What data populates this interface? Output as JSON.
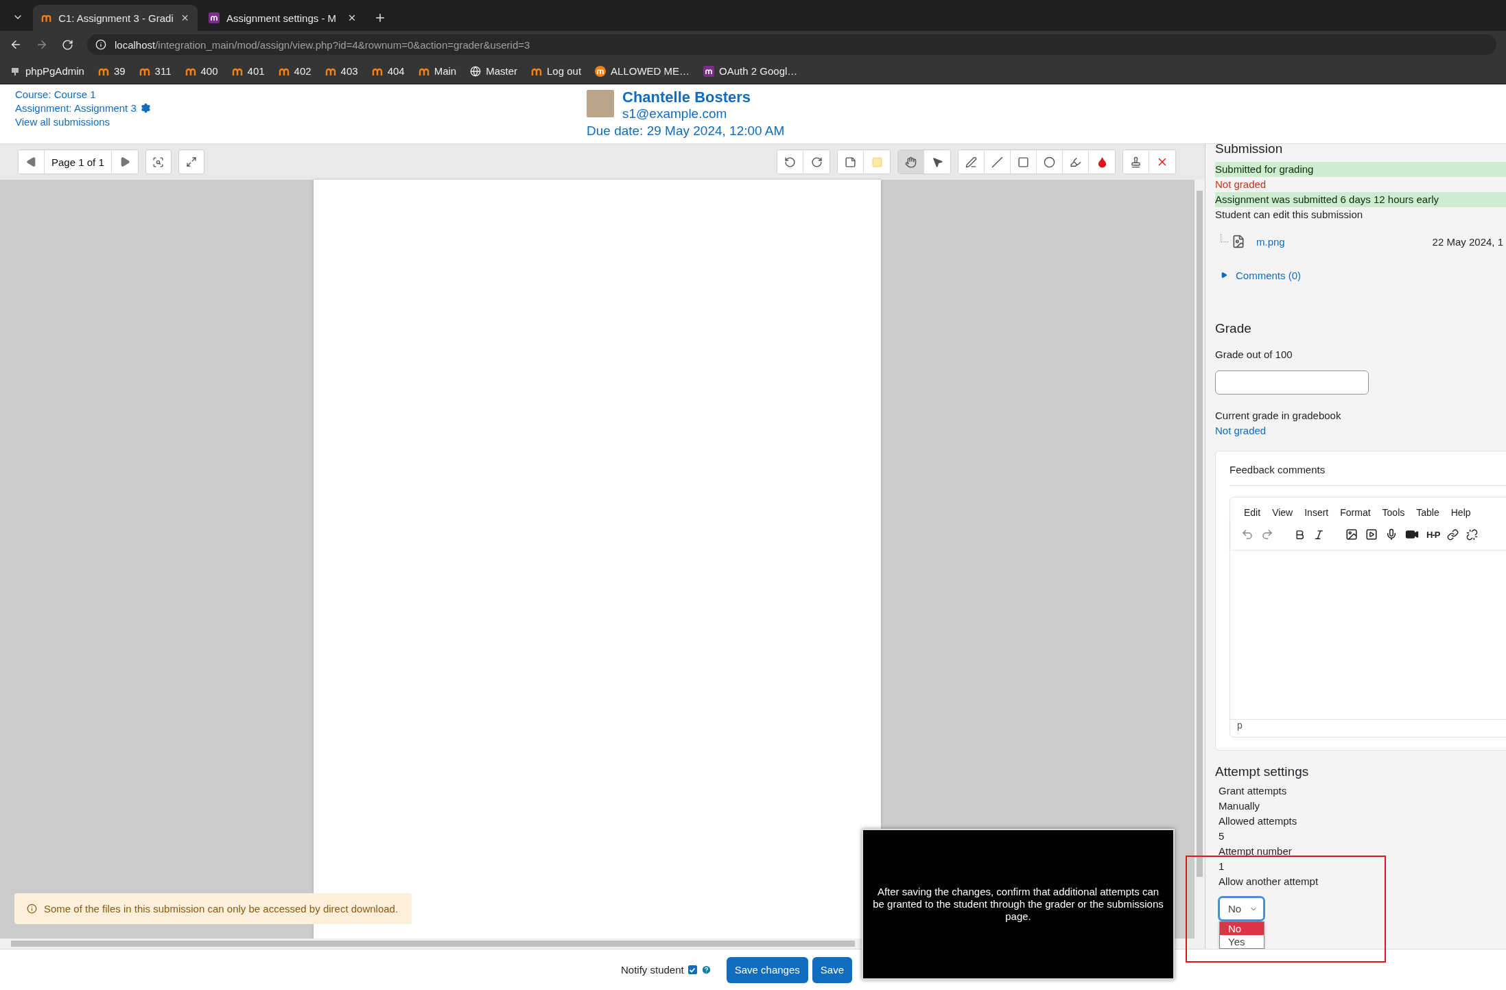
{
  "browser": {
    "tabs": [
      {
        "title": "C1: Assignment 3 - Gradi",
        "selected": true
      },
      {
        "title": "Assignment settings - M",
        "selected": false
      }
    ],
    "url_host": "localhost",
    "url_path": "/integration_main/mod/assign/view.php?id=4&rownum=0&action=grader&userid=3",
    "bookmarks": [
      {
        "label": "phpPgAdmin",
        "kind": "elephant"
      },
      {
        "label": "39",
        "kind": "moodle"
      },
      {
        "label": "311",
        "kind": "moodle"
      },
      {
        "label": "400",
        "kind": "moodle"
      },
      {
        "label": "401",
        "kind": "moodle"
      },
      {
        "label": "402",
        "kind": "moodle"
      },
      {
        "label": "403",
        "kind": "moodle"
      },
      {
        "label": "404",
        "kind": "moodle"
      },
      {
        "label": "Main",
        "kind": "moodle"
      },
      {
        "label": "Master",
        "kind": "globe"
      },
      {
        "label": "Log out",
        "kind": "moodle"
      },
      {
        "label": "ALLOWED ME…",
        "kind": "circle"
      },
      {
        "label": "OAuth 2 Googl…",
        "kind": "square"
      }
    ]
  },
  "header": {
    "course_link": "Course: Course 1",
    "assignment_link": "Assignment: Assignment 3",
    "submissions_link": "View all submissions",
    "user_name": "Chantelle Bosters",
    "user_email": "s1@example.com",
    "due_date": "Due date: 29 May 2024, 12:00 AM"
  },
  "viewer": {
    "page_label": "Page 1 of 1",
    "tools": [
      {
        "kind": "hand",
        "selected": true
      },
      {
        "kind": "pointer",
        "selected": false
      }
    ],
    "draw_tools": [
      {
        "kind": "pen",
        "selected": false
      },
      {
        "kind": "line",
        "selected": false
      },
      {
        "kind": "rectangle",
        "selected": false
      },
      {
        "kind": "oval",
        "selected": false
      },
      {
        "kind": "highlight",
        "selected": false
      },
      {
        "kind": "color",
        "selected": false
      }
    ],
    "notice": "Some of the files in this submission can only be accessed by direct download."
  },
  "submission": {
    "heading": "Submission",
    "statuses": [
      {
        "text": "Submitted for grading",
        "kind": "success"
      },
      {
        "text": "Not graded",
        "kind": "danger"
      },
      {
        "text": "Assignment was submitted 6 days 12 hours early",
        "kind": "success"
      },
      {
        "text": "Student can edit this submission",
        "kind": "plain"
      }
    ],
    "file": {
      "name": "m.png",
      "date": "22 May 2024, 1"
    },
    "comments_link": "Comments (0)"
  },
  "grade": {
    "heading": "Grade",
    "label": "Grade out of 100",
    "current_label": "Current grade in gradebook",
    "current_value": "Not graded"
  },
  "feedback": {
    "label": "Feedback comments",
    "menu": [
      "Edit",
      "View",
      "Insert",
      "Format",
      "Tools",
      "Table",
      "Help"
    ],
    "h5p_label": "H-P",
    "status_path": "p"
  },
  "attempts": {
    "heading": "Attempt settings",
    "fields": [
      {
        "label": "Grant attempts",
        "value": "Manually"
      },
      {
        "label": "Allowed attempts",
        "value": "5"
      },
      {
        "label": "Attempt number",
        "value": "1"
      }
    ],
    "allow_label": "Allow another attempt",
    "select_value": "No",
    "options": [
      {
        "label": "No",
        "selected": true
      },
      {
        "label": "Yes",
        "selected": false
      }
    ]
  },
  "footer": {
    "notify_label": "Notify student",
    "notify_checked": true,
    "save_changes": "Save changes",
    "save_next": "Save"
  },
  "tooltip": "After saving the changes, confirm that additional attempts can be granted to the student through the grader or the submissions page."
}
